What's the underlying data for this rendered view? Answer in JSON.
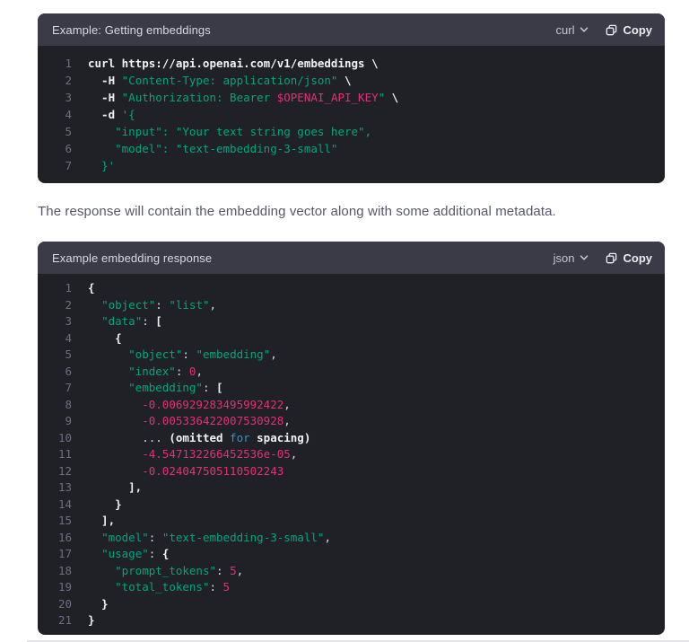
{
  "colors": {
    "page_bg": "#ffffff",
    "header_bg": "#3a3b47",
    "code_bg": "#202127",
    "string_green": "#00a67d",
    "number_pink": "#df3079",
    "keyword_blue": "#2e95d3",
    "line_number_gray": "#6e6e80"
  },
  "prose": {
    "text": "The response will contain the embedding vector along with some additional metadata."
  },
  "blocks": {
    "curl_block": {
      "title": "Example: Getting embeddings",
      "language": "curl",
      "copy_label": "Copy",
      "lines": [
        [
          {
            "t": "curl https://api.openai.com/v1/embeddings \\",
            "s": "cmd"
          }
        ],
        [
          {
            "t": "  -H ",
            "s": "cmd"
          },
          {
            "t": "\"Content-Type: application/json\"",
            "s": "str"
          },
          {
            "t": " \\",
            "s": "cmd"
          }
        ],
        [
          {
            "t": "  -H ",
            "s": "cmd"
          },
          {
            "t": "\"Authorization: Bearer ",
            "s": "str"
          },
          {
            "t": "$OPENAI_API_KEY",
            "s": "num"
          },
          {
            "t": "\"",
            "s": "str"
          },
          {
            "t": " \\",
            "s": "cmd"
          }
        ],
        [
          {
            "t": "  -d ",
            "s": "cmd"
          },
          {
            "t": "'{",
            "s": "str"
          }
        ],
        [
          {
            "t": "    \"input\": \"Your text string goes here\",",
            "s": "str"
          }
        ],
        [
          {
            "t": "    \"model\": \"text-embedding-3-small\"",
            "s": "str"
          }
        ],
        [
          {
            "t": "  }'",
            "s": "str"
          }
        ]
      ]
    },
    "json_block": {
      "title": "Example embedding response",
      "language": "json",
      "copy_label": "Copy",
      "lines": [
        [
          {
            "t": "{",
            "s": "cmd"
          }
        ],
        [
          {
            "t": "  ",
            "s": "plain"
          },
          {
            "t": "\"object\"",
            "s": "str"
          },
          {
            "t": ": ",
            "s": "plain"
          },
          {
            "t": "\"list\"",
            "s": "str"
          },
          {
            "t": ",",
            "s": "plain"
          }
        ],
        [
          {
            "t": "  ",
            "s": "plain"
          },
          {
            "t": "\"data\"",
            "s": "str"
          },
          {
            "t": ": ",
            "s": "plain"
          },
          {
            "t": "[",
            "s": "cmd"
          }
        ],
        [
          {
            "t": "    {",
            "s": "cmd"
          }
        ],
        [
          {
            "t": "      ",
            "s": "plain"
          },
          {
            "t": "\"object\"",
            "s": "str"
          },
          {
            "t": ": ",
            "s": "plain"
          },
          {
            "t": "\"embedding\"",
            "s": "str"
          },
          {
            "t": ",",
            "s": "plain"
          }
        ],
        [
          {
            "t": "      ",
            "s": "plain"
          },
          {
            "t": "\"index\"",
            "s": "str"
          },
          {
            "t": ": ",
            "s": "plain"
          },
          {
            "t": "0",
            "s": "num"
          },
          {
            "t": ",",
            "s": "plain"
          }
        ],
        [
          {
            "t": "      ",
            "s": "plain"
          },
          {
            "t": "\"embedding\"",
            "s": "str"
          },
          {
            "t": ": ",
            "s": "plain"
          },
          {
            "t": "[",
            "s": "cmd"
          }
        ],
        [
          {
            "t": "        ",
            "s": "plain"
          },
          {
            "t": "-0.006929283495992422",
            "s": "num"
          },
          {
            "t": ",",
            "s": "plain"
          }
        ],
        [
          {
            "t": "        ",
            "s": "plain"
          },
          {
            "t": "-0.005336422007530928",
            "s": "num"
          },
          {
            "t": ",",
            "s": "plain"
          }
        ],
        [
          {
            "t": "        ... ",
            "s": "plain"
          },
          {
            "t": "(omitted ",
            "s": "cmd"
          },
          {
            "t": "for",
            "s": "kw"
          },
          {
            "t": " spacing)",
            "s": "cmd"
          }
        ],
        [
          {
            "t": "        ",
            "s": "plain"
          },
          {
            "t": "-4.547132266452536e-05",
            "s": "num"
          },
          {
            "t": ",",
            "s": "plain"
          }
        ],
        [
          {
            "t": "        ",
            "s": "plain"
          },
          {
            "t": "-0.024047505110502243",
            "s": "num"
          }
        ],
        [
          {
            "t": "      ],",
            "s": "cmd"
          }
        ],
        [
          {
            "t": "    }",
            "s": "cmd"
          }
        ],
        [
          {
            "t": "  ],",
            "s": "cmd"
          }
        ],
        [
          {
            "t": "  ",
            "s": "plain"
          },
          {
            "t": "\"model\"",
            "s": "str"
          },
          {
            "t": ": ",
            "s": "plain"
          },
          {
            "t": "\"text-embedding-3-small\"",
            "s": "str"
          },
          {
            "t": ",",
            "s": "plain"
          }
        ],
        [
          {
            "t": "  ",
            "s": "plain"
          },
          {
            "t": "\"usage\"",
            "s": "str"
          },
          {
            "t": ": ",
            "s": "plain"
          },
          {
            "t": "{",
            "s": "cmd"
          }
        ],
        [
          {
            "t": "    ",
            "s": "plain"
          },
          {
            "t": "\"prompt_tokens\"",
            "s": "str"
          },
          {
            "t": ": ",
            "s": "plain"
          },
          {
            "t": "5",
            "s": "num"
          },
          {
            "t": ",",
            "s": "plain"
          }
        ],
        [
          {
            "t": "    ",
            "s": "plain"
          },
          {
            "t": "\"total_tokens\"",
            "s": "str"
          },
          {
            "t": ": ",
            "s": "plain"
          },
          {
            "t": "5",
            "s": "num"
          }
        ],
        [
          {
            "t": "  }",
            "s": "cmd"
          }
        ],
        [
          {
            "t": "}",
            "s": "cmd"
          }
        ]
      ]
    }
  }
}
